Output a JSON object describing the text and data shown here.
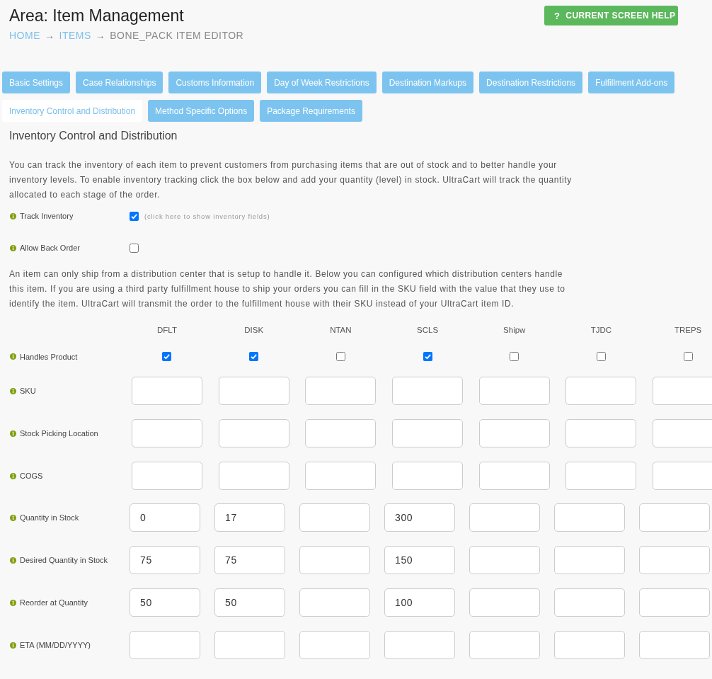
{
  "header": {
    "title": "Area: Item Management",
    "breadcrumb": [
      {
        "label": "HOME",
        "current": false,
        "separator": "→"
      },
      {
        "label": "ITEMS",
        "current": false,
        "separator": "→"
      },
      {
        "label": "BONE_PACK ITEM EDITOR",
        "current": true
      }
    ],
    "help_button": {
      "icon": "?",
      "label": "CURRENT SCREEN HELP"
    }
  },
  "tabs": [
    {
      "label": "Basic Settings",
      "selected": false
    },
    {
      "label": "Case Relationships",
      "selected": false
    },
    {
      "label": "Customs Information",
      "selected": false
    },
    {
      "label": "Day of Week Restrictions",
      "selected": false
    },
    {
      "label": "Destination Markups",
      "selected": false
    },
    {
      "label": "Destination Restrictions",
      "selected": false
    },
    {
      "label": "Fulfillment Add-ons",
      "selected": false
    },
    {
      "label": "Inventory Control and Distribution",
      "selected": true
    },
    {
      "label": "Method Specific Options",
      "selected": false
    },
    {
      "label": "Package Requirements",
      "selected": false
    }
  ],
  "section": {
    "title": "Inventory Control and Distribution",
    "intro": "You can track the inventory of each item to prevent customers from purchasing items that are out of stock and to better handle your inventory levels. To enable inventory tracking click the box below and add your quantity (level) in stock. UltraCart will track the quantity allocated to each stage of the order.",
    "fields": [
      {
        "label": "Track Inventory",
        "checked": true,
        "note": "(click here to show inventory fields)"
      },
      {
        "label": "Allow Back Order",
        "checked": false
      }
    ],
    "distribution_note": "An item can only ship from a distribution center that is setup to handle it. Below you can configured which distribution centers handle this item. If you are using a third party fulfillment house to ship your orders you can fill in the SKU field with the value that they use to identify the item. UltraCart will transmit the order to the fulfillment house with their SKU instead of your UltraCart item ID."
  },
  "distribution_table": {
    "columns": [
      "DFLT",
      "DISK",
      "NTAN",
      "SCLS",
      "Shipw",
      "TJDC",
      "TREPS"
    ],
    "rows": [
      {
        "label": "Handles Product",
        "kind": "checkbox",
        "cells": [
          {
            "checked": true
          },
          {
            "checked": true
          },
          {
            "checked": false
          },
          {
            "checked": true
          },
          {
            "checked": false
          },
          {
            "checked": false
          },
          {
            "checked": false
          }
        ]
      },
      {
        "label": "SKU",
        "kind": "input",
        "cells": [
          {},
          {},
          {},
          {},
          {},
          {},
          {}
        ]
      },
      {
        "label": "Stock Picking Location",
        "kind": "input",
        "cells": [
          {},
          {},
          {},
          {},
          {},
          {},
          {}
        ]
      },
      {
        "label": "COGS",
        "kind": "input",
        "cells": [
          {},
          {},
          {},
          {},
          {},
          {},
          {}
        ]
      }
    ]
  },
  "stock_table": {
    "rows": [
      {
        "label": "Quantity in Stock",
        "kind": "input",
        "cells": [
          {
            "value": "0"
          },
          {
            "value": "17"
          },
          {},
          {
            "value": "300"
          },
          {},
          {},
          {}
        ]
      },
      {
        "label": "Desired Quantity in Stock",
        "kind": "input",
        "cells": [
          {
            "value": "75"
          },
          {
            "value": "75"
          },
          {},
          {
            "value": "150"
          },
          {},
          {},
          {}
        ]
      },
      {
        "label": "Reorder at Quantity",
        "kind": "input",
        "cells": [
          {
            "value": "50"
          },
          {
            "value": "50"
          },
          {},
          {
            "value": "100"
          },
          {},
          {},
          {}
        ]
      },
      {
        "label": "ETA (MM/DD/YYYY)",
        "kind": "input",
        "cells": [
          {},
          {},
          {},
          {},
          {},
          {},
          {}
        ]
      }
    ]
  }
}
